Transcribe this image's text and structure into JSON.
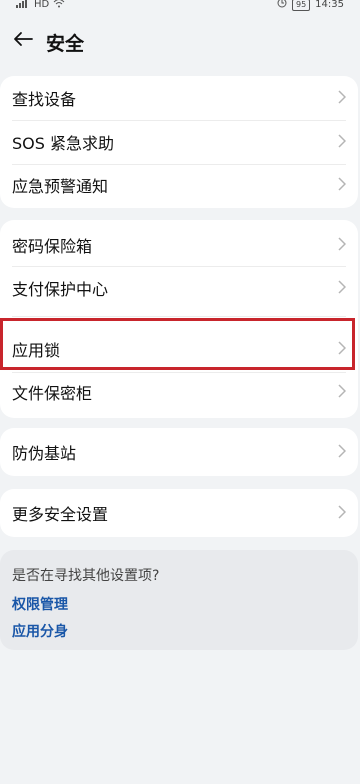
{
  "status_bar": {
    "carrier_text": "HD",
    "battery": "95",
    "time": "14:35"
  },
  "header": {
    "title": "安全",
    "back_icon": "arrow-left-icon"
  },
  "groups": [
    {
      "items": [
        "查找设备",
        "SOS 紧急求助",
        "应急预警通知"
      ]
    },
    {
      "items": [
        "密码保险箱",
        "支付保护中心",
        "应用锁",
        "文件保密柜"
      ]
    },
    {
      "items": [
        "防伪基站"
      ]
    },
    {
      "items": [
        "更多安全设置"
      ]
    }
  ],
  "suggestions": {
    "question": "是否在寻找其他设置项?",
    "links": [
      "权限管理",
      "应用分身"
    ]
  },
  "colors": {
    "highlight": "#c8252c",
    "link": "#1a57a8"
  }
}
